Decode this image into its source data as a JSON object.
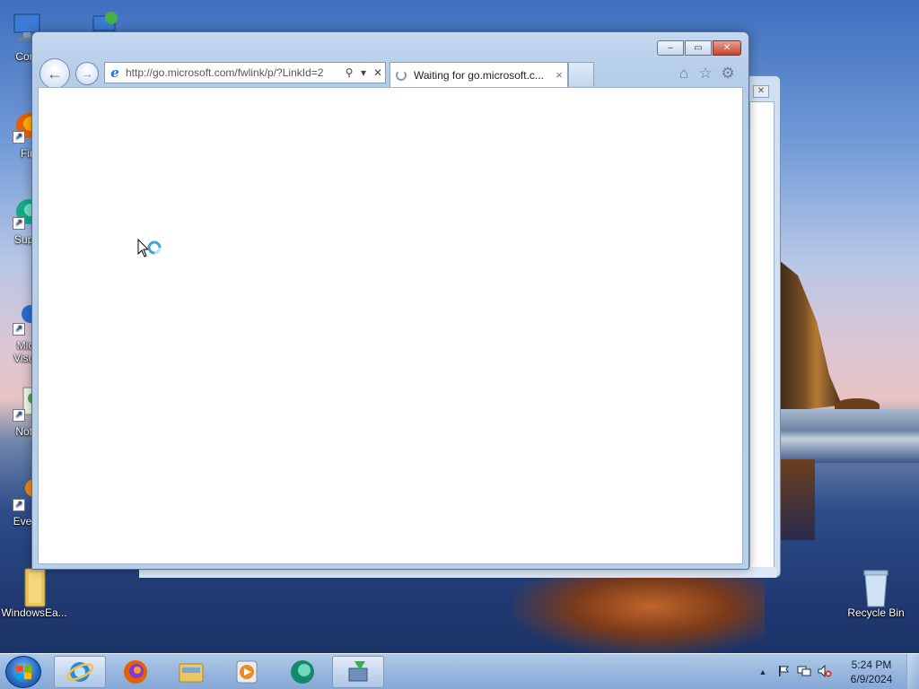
{
  "desktop": {
    "icons": [
      {
        "label": "Com"
      },
      {
        "label": "Fir"
      },
      {
        "label": "Supe"
      },
      {
        "label": "Micr"
      },
      {
        "label": "Visua"
      },
      {
        "label": "Note"
      },
      {
        "label": "Every"
      },
      {
        "label": "WindowsEa..."
      },
      {
        "label": "Recycle Bin"
      }
    ]
  },
  "browser": {
    "address": "http://go.microsoft.com/fwlink/p/?LinkId=2",
    "tab_title": "Waiting for go.microsoft.c...",
    "tab_close": "×",
    "address_search": "⚲",
    "address_dropdown": "▾",
    "address_stop": "✕",
    "nav_back": "←",
    "nav_forward": "→",
    "home_icon": "⌂",
    "favorites_icon": "☆",
    "tools_icon": "⚙",
    "minimize": "–",
    "maximize": "▭",
    "close": "✕"
  },
  "background_window": {
    "close": "✕"
  },
  "taskbar": {
    "items": [
      {
        "name": "Internet Explorer",
        "active": true
      },
      {
        "name": "Firefox",
        "active": false
      },
      {
        "name": "File Explorer",
        "active": false
      },
      {
        "name": "Media Player",
        "active": false
      },
      {
        "name": "App",
        "active": false
      },
      {
        "name": "Installer",
        "active": true
      }
    ],
    "time": "5:24 PM",
    "date": "6/9/2024",
    "tray_expand": "▲"
  }
}
